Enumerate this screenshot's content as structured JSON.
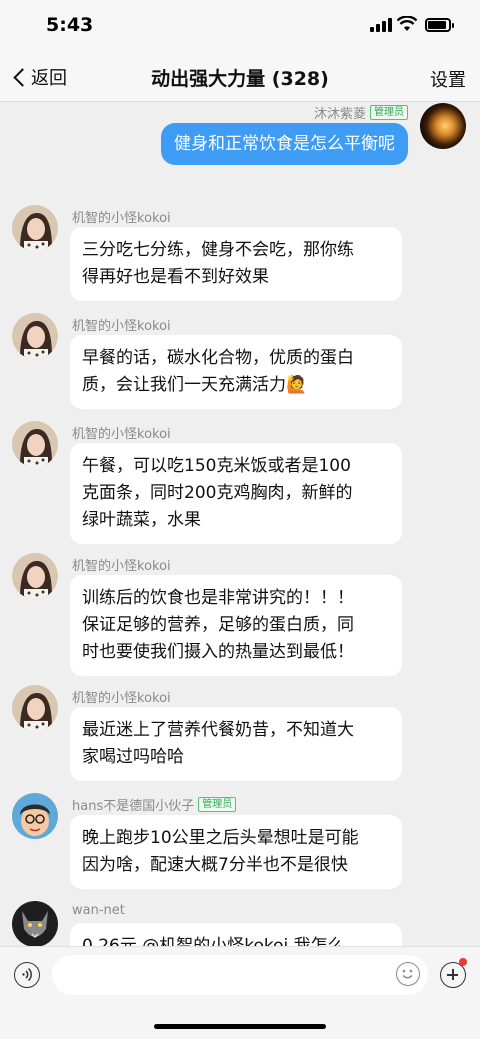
{
  "status_bar": {
    "time": "5:43"
  },
  "nav": {
    "back_label": "返回",
    "title": "动出强大力量 (328)",
    "settings_label": "设置"
  },
  "self_message": {
    "sender": "沐沐紫菱",
    "badge": "管理员",
    "text": "健身和正常饮食是怎么平衡呢"
  },
  "messages": [
    {
      "sender": "机智的小怪kokoi",
      "badge": "",
      "lines": [
        "三分吃七分练，健身不会吃，那你练",
        "得再好也是看不到好效果"
      ]
    },
    {
      "sender": "机智的小怪kokoi",
      "badge": "",
      "lines": [
        "早餐的话，碳水化合物，优质的蛋白",
        "质，会让我们一天充满活力🙋"
      ]
    },
    {
      "sender": "机智的小怪kokoi",
      "badge": "",
      "lines": [
        "午餐，可以吃150克米饭或者是100",
        "克面条，同时200克鸡胸肉，新鲜的",
        "绿叶蔬菜，水果"
      ]
    },
    {
      "sender": "机智的小怪kokoi",
      "badge": "",
      "lines": [
        "训练后的饮食也是非常讲究的！！！",
        "保证足够的营养，足够的蛋白质，同",
        "时也要使我们摄入的热量达到最低！"
      ]
    },
    {
      "sender": "机智的小怪kokoi",
      "badge": "",
      "lines": [
        "最近迷上了营养代餐奶昔，不知道大",
        "家喝过吗哈哈"
      ]
    },
    {
      "sender": "hans不是德国小伙子",
      "badge": "管理员",
      "lines": [
        "晚上跑步10公里之后头晕想吐是可能",
        "因为啥，配速大概7分半也不是很快"
      ]
    },
    {
      "sender": "wan-net",
      "badge": "",
      "lines": [
        "0.26元 @机智的小怪kokoi 我怎么"
      ]
    }
  ],
  "input": {
    "placeholder": ""
  },
  "colors": {
    "self_bubble": "#3f9cf4",
    "badge_green": "#32a852",
    "background": "#efefef"
  },
  "icons": [
    "signal-icon",
    "wifi-icon",
    "battery-icon",
    "back-chevron-icon",
    "voice-icon",
    "emoji-icon",
    "plus-icon"
  ]
}
